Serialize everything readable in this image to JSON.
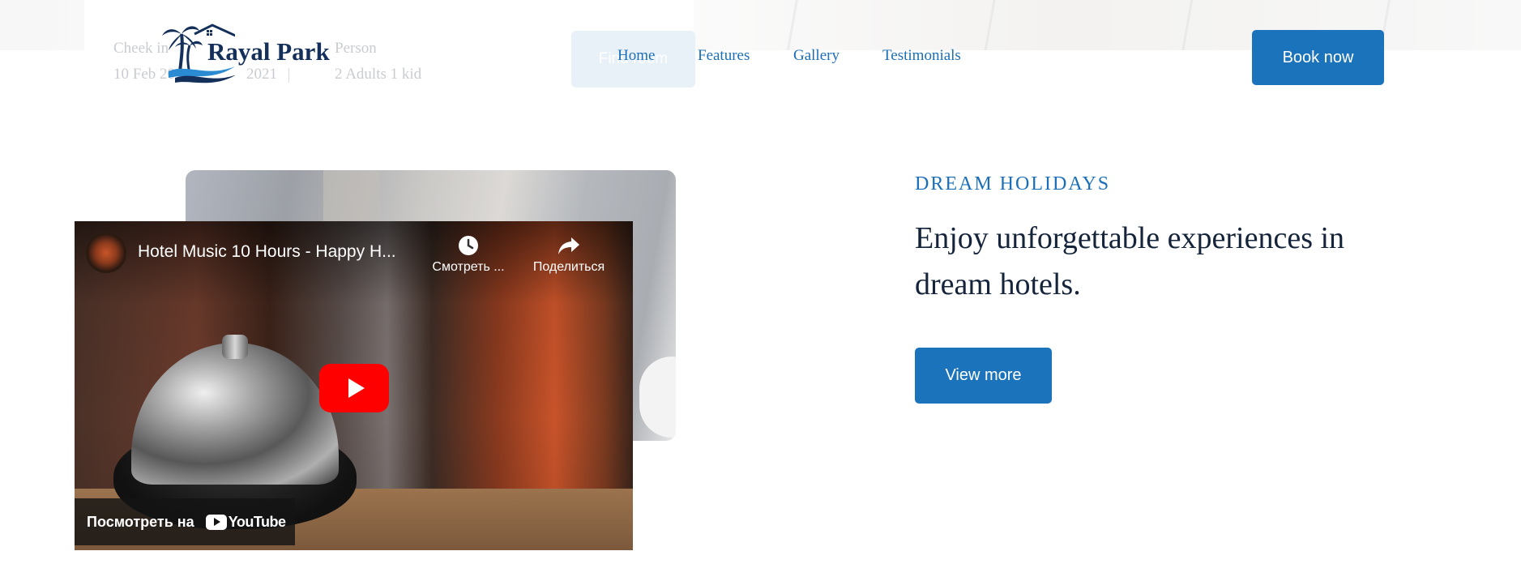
{
  "booking": {
    "checkin_label": "Cheek in",
    "person_label": "Person",
    "checkin_date": "10 Feb 20",
    "checkout_date": "2021",
    "guests": "2 Adults 1 kid",
    "find_room": "Find room"
  },
  "logo": {
    "text": "Rayal Park"
  },
  "nav": {
    "items": [
      {
        "label": "Home"
      },
      {
        "label": "Features"
      },
      {
        "label": "Gallery"
      },
      {
        "label": "Testimonials"
      }
    ],
    "book_now": "Book now"
  },
  "video": {
    "title": "Hotel Music 10 Hours - Happy H...",
    "watch_later": "Смотреть ...",
    "share": "Поделиться",
    "watch_on": "Посмотреть на",
    "platform": "YouTube"
  },
  "promo": {
    "eyebrow": "DREAM HOLIDAYS",
    "headline": "Enjoy unforgettable experiences in dream hotels.",
    "cta": "View more"
  },
  "colors": {
    "accent": "#1b73bb",
    "link": "#1b6fb8",
    "heading": "#15243a",
    "youtube_red": "#ff0000"
  }
}
